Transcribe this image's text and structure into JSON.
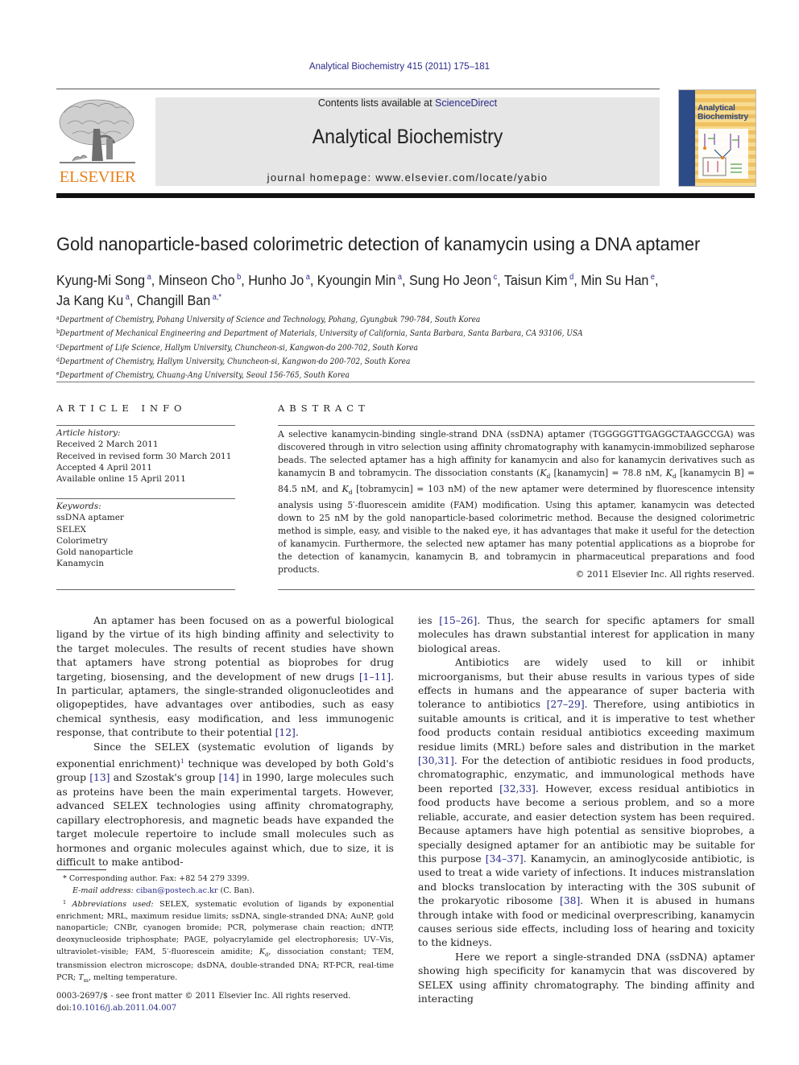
{
  "header": {
    "citation": "Analytical Biochemistry 415 (2011) 175–181",
    "contents_prefix": "Contents lists available at ",
    "contents_link": "ScienceDirect",
    "journal_name": "Analytical Biochemistry",
    "homepage": "journal homepage: www.elsevier.com/locate/yabio",
    "publisher_logo_text": "ELSEVIER",
    "publisher_color": "#e8811b",
    "cover": {
      "title_line1": "Analytical",
      "title_line2": "Biochemistry"
    }
  },
  "article": {
    "title": "Gold nanoparticle-based colorimetric detection of kanamycin using a DNA aptamer",
    "authors": [
      {
        "name": "Kyung-Mi Song",
        "aff": "a"
      },
      {
        "name": "Minseon Cho",
        "aff": "b"
      },
      {
        "name": "Hunho Jo",
        "aff": "a"
      },
      {
        "name": "Kyoungin Min",
        "aff": "a"
      },
      {
        "name": "Sung Ho Jeon",
        "aff": "c"
      },
      {
        "name": "Taisun Kim",
        "aff": "d"
      },
      {
        "name": "Min Su Han",
        "aff": "e"
      },
      {
        "name": "Ja Kang Ku",
        "aff": "a"
      },
      {
        "name": "Changill Ban",
        "aff": "a,*"
      }
    ],
    "affiliations": [
      {
        "key": "a",
        "text": "Department of Chemistry, Pohang University of Science and Technology, Pohang, Gyungbuk 790-784, South Korea"
      },
      {
        "key": "b",
        "text": "Department of Mechanical Engineering and Department of Materials, University of California, Santa Barbara, Santa Barbara, CA 93106, USA"
      },
      {
        "key": "c",
        "text": "Department of Life Science, Hallym University, Chuncheon-si, Kangwon-do 200-702, South Korea"
      },
      {
        "key": "d",
        "text": "Department of Chemistry, Hallym University, Chuncheon-si, Kangwon-do 200-702, South Korea"
      },
      {
        "key": "e",
        "text": "Department of Chemistry, Chuang-Ang University, Seoul 156-765, South Korea"
      }
    ]
  },
  "article_info": {
    "heading": "ARTICLE INFO",
    "history_label": "Article history:",
    "history": [
      "Received 2 March 2011",
      "Received in revised form 30 March 2011",
      "Accepted 4 April 2011",
      "Available online 15 April 2011"
    ],
    "keywords_label": "Keywords:",
    "keywords": [
      "ssDNA aptamer",
      "SELEX",
      "Colorimetry",
      "Gold nanoparticle",
      "Kanamycin"
    ]
  },
  "abstract": {
    "heading": "ABSTRACT",
    "p1": "A selective kanamycin-binding single-strand DNA (ssDNA) aptamer (TGGGGGTTGAGGCTAAGCCGA) was discovered through in vitro selection using affinity chromatography with kanamycin-immobilized sepharose beads. The selected aptamer has a high affinity for kanamycin and also for kanamycin derivatives such as kanamycin B and tobramycin. The dissociation constants (",
    "kd_symbol": "K",
    "kd_sub": "d",
    "kd1": " [kanamycin] = 78.8 nM, ",
    "kd2": " [kanamycin B] = 84.5 nM, and ",
    "kd3": " [tobramycin] = 103 nM) of the new aptamer were determined by fluorescence intensity analysis using 5′-fluorescein amidite (FAM) modification. Using this aptamer, kanamycin was detected down to 25 nM by the gold nanoparticle-based colorimetric method. Because the designed colorimetric method is simple, easy, and visible to the naked eye, it has advantages that make it useful for the detection of kanamycin. Furthermore, the selected new aptamer has many potential applications as a bioprobe for the detection of kanamycin, kanamycin B, and tobramycin in pharmaceutical preparations and food products.",
    "copyright": "© 2011 Elsevier Inc. All rights reserved."
  },
  "body": {
    "left": {
      "p1a": "An aptamer has been focused on as a powerful biological ligand by the virtue of its high binding affinity and selectivity to the target molecules. The results of recent studies have shown that aptamers have strong potential as bioprobes for drug targeting, biosensing, and the development of new drugs ",
      "p1_ref1": "[1–11]",
      "p1b": ". In particular, aptamers, the single-stranded oligonucleotides and oligopeptides, have advantages over antibodies, such as easy chemical synthesis, easy modification, and less immunogenic response, that contribute to their potential ",
      "p1_ref2": "[12]",
      "p1c": ".",
      "p2a": "Since the SELEX (systematic evolution of ligands by exponential enrichment)",
      "p2_fn": "1",
      "p2b": " technique was developed by both Gold's group ",
      "p2_ref1": "[13]",
      "p2c": " and Szostak's group ",
      "p2_ref2": "[14]",
      "p2d": " in 1990, large molecules such as proteins have been the main experimental targets. However, advanced SELEX technologies using affinity chromatography, capillary electrophoresis, and magnetic beads have expanded the target molecule repertoire to include small molecules such as hormones and organic molecules against which, due to size, it is difficult to make antibod-"
    },
    "right": {
      "p0a": "ies ",
      "p0_ref": "[15–26]",
      "p0b": ". Thus, the search for specific aptamers for small molecules has drawn substantial interest for application in many biological areas.",
      "p1a": "Antibiotics are widely used to kill or inhibit microorganisms, but their abuse results in various types of side effects in humans and the appearance of super bacteria with tolerance to antibiotics ",
      "p1_ref1": "[27–29]",
      "p1b": ". Therefore, using antibiotics in suitable amounts is critical, and it is imperative to test whether food products contain residual antibiotics exceeding maximum residue limits (MRL) before sales and distribution in the market ",
      "p1_ref2": "[30,31]",
      "p1c": ". For the detection of antibiotic residues in food products, chromatographic, enzymatic, and immunological methods have been reported ",
      "p1_ref3": "[32,33]",
      "p1d": ". However, excess residual antibiotics in food products have become a serious problem, and so a more reliable, accurate, and easier detection system has been required. Because aptamers have high potential as sensitive bioprobes, a specially designed aptamer for an antibiotic may be suitable for this purpose ",
      "p1_ref4": "[34–37]",
      "p1e": ". Kanamycin, an aminoglycoside antibiotic, is used to treat a wide variety of infections. It induces mistranslation and blocks translocation by interacting with the 30S subunit of the prokaryotic ribosome ",
      "p1_ref5": "[38]",
      "p1f": ". When it is abused in humans through intake with food or medicinal overprescribing, kanamycin causes serious side effects, including loss of hearing and toxicity to the kidneys.",
      "p2": "Here we report a single-stranded DNA (ssDNA) aptamer showing high specificity for kanamycin that was discovered by SELEX using affinity chromatography. The binding affinity and interacting"
    }
  },
  "footnotes": {
    "corresponding_mark": "*",
    "corresponding": " Corresponding author. Fax: +82 54 279 3399.",
    "email_label": "E-mail address: ",
    "email": "ciban@postech.ac.kr",
    "email_suffix": " (C. Ban).",
    "abbrev_mark": "1",
    "abbrev_label": "Abbreviations used:",
    "abbrev_text_a": " SELEX, systematic evolution of ligands by exponential enrichment; MRL, maximum residue limits; ssDNA, single-stranded DNA; AuNP, gold nanoparticle; CNBr, cyanogen bromide; PCR, polymerase chain reaction; dNTP, deoxynucleoside triphosphate; PAGE, polyacrylamide gel electrophoresis; UV–Vis, ultraviolet–visible; FAM, 5′-fluorescein amidite; ",
    "abbrev_kd": "K",
    "abbrev_kd_sub": "d",
    "abbrev_text_b": ", dissociation constant; TEM, transmission electron microscope; dsDNA, double-stranded DNA; RT-PCR, real-time PCR; ",
    "abbrev_tm": "T",
    "abbrev_tm_sub": "m",
    "abbrev_text_c": ", melting temperature."
  },
  "issn": {
    "line1": "0003-2697/$ - see front matter © 2011 Elsevier Inc. All rights reserved.",
    "doi_label": "doi:",
    "doi": "10.1016/j.ab.2011.04.007"
  }
}
